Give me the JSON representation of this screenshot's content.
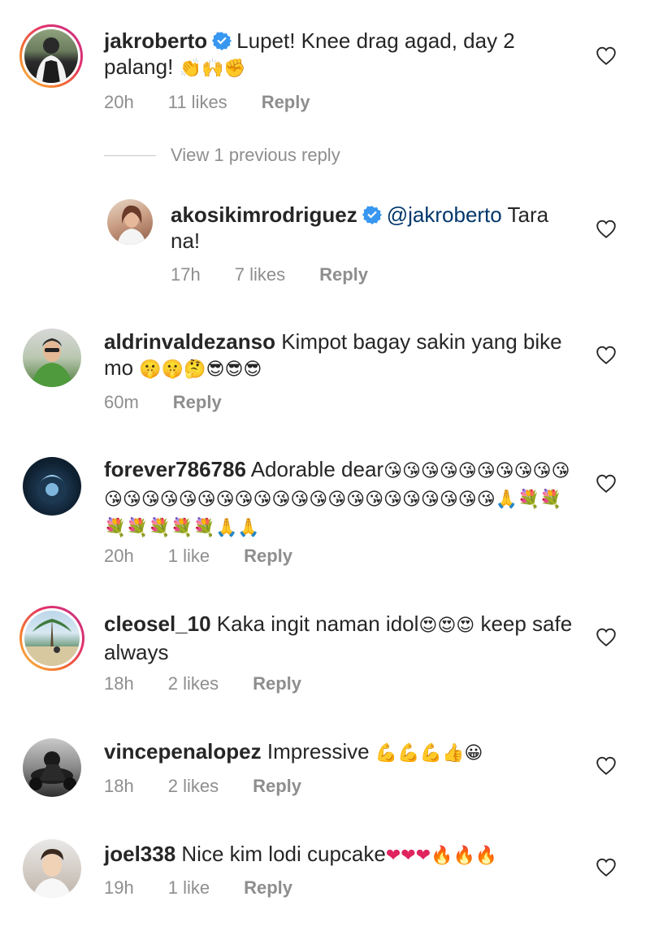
{
  "comments": [
    {
      "username": "jakroberto",
      "verified": true,
      "text": "Lupet! Knee drag agad, day 2 palang!",
      "emoji": "👏🙌✊",
      "time": "20h",
      "likes": "11 likes",
      "reply": "Reply"
    },
    {
      "view_replies": "View 1 previous reply"
    },
    {
      "username": "akosikimrodriguez",
      "verified": true,
      "mention": "@jakroberto",
      "text": " Tara na!",
      "time": "17h",
      "likes": "7 likes",
      "reply": "Reply"
    },
    {
      "username": "aldrinvaldezanso",
      "text": "Kimpot bagay sakin yang bike mo",
      "emoji": "🤫🤫🤔😎😎😎",
      "time": "60m",
      "reply": "Reply"
    },
    {
      "username": "forever786786",
      "text": "Adorable dear",
      "emoji": "😘😘😘😘😘😘😘😘😘😘😘😘😘😘😘😘😘😘😘😘😘😘😘😘😘😘😘😘😘😘😘🙏💐💐💐💐💐💐💐🙏🙏",
      "time": "20h",
      "likes": "1 like",
      "reply": "Reply"
    },
    {
      "username": "cleosel_10",
      "text": "Kaka ingit naman idol",
      "emoji": "😍😍😍",
      "text2": " keep safe always",
      "time": "18h",
      "likes": "2 likes",
      "reply": "Reply"
    },
    {
      "username": "vincepenalopez",
      "text": "Impressive ",
      "emoji": "💪💪💪👍😀",
      "time": "18h",
      "likes": "2 likes",
      "reply": "Reply"
    },
    {
      "username": "joel338",
      "text": "Nice kim lodi cupcake",
      "emoji": "❤❤❤🔥🔥🔥",
      "time": "19h",
      "likes": "1 like",
      "reply": "Reply"
    }
  ],
  "colors": {
    "text": "#262626",
    "muted": "#8e8e8e",
    "verified": "#3897f0",
    "mention": "#00376b"
  },
  "icons": {
    "like": "heart-outline-icon",
    "verified": "verified-badge-icon"
  }
}
